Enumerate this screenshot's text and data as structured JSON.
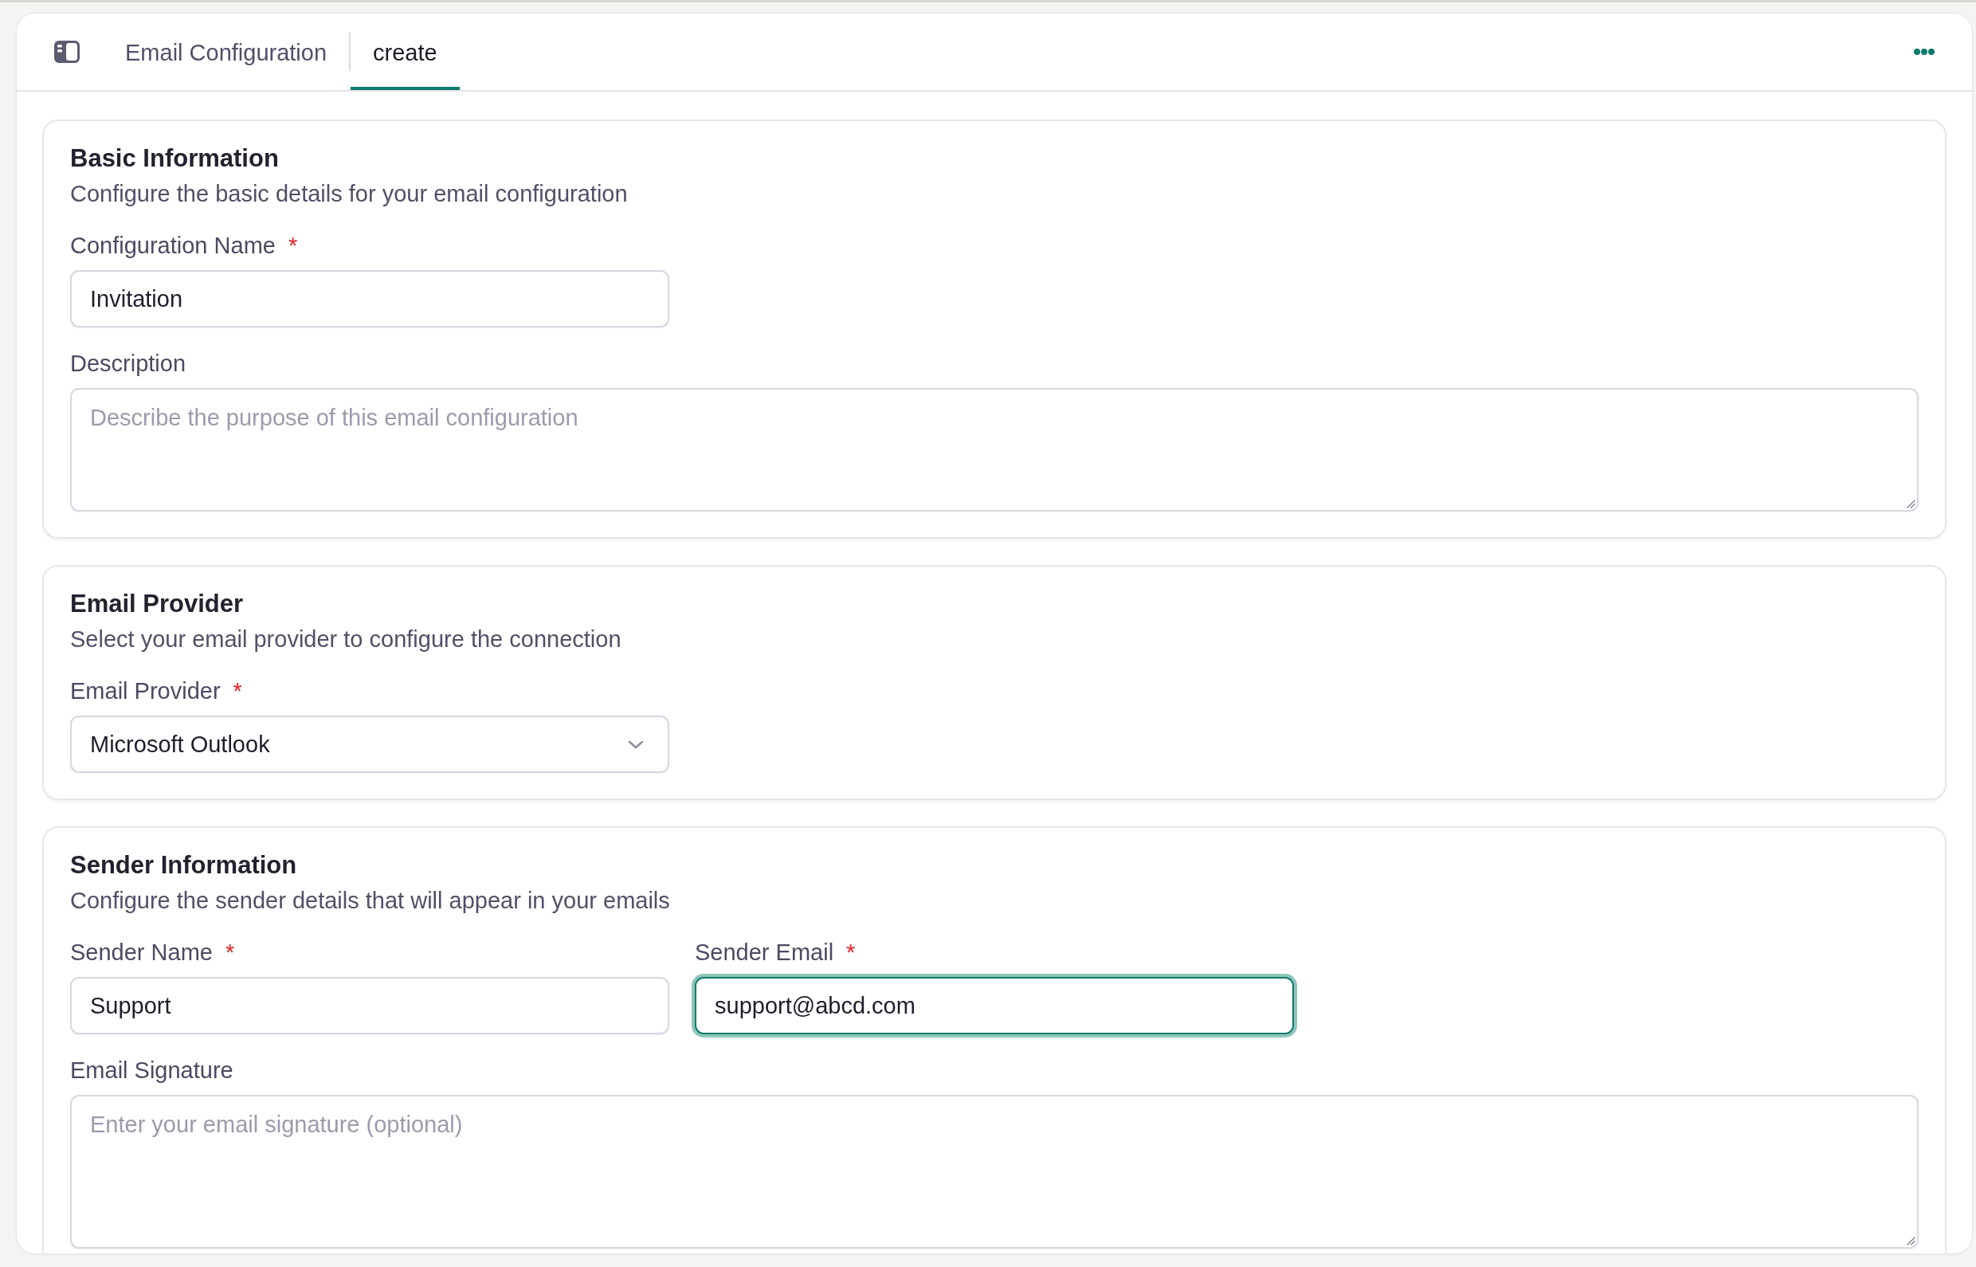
{
  "tabs": [
    {
      "label": "Email Configuration",
      "selected": false
    },
    {
      "label": "create",
      "selected": true
    }
  ],
  "sections": [
    {
      "title": "Basic Information",
      "subtitle": "Configure the basic details for your email configuration",
      "fields": [
        {
          "kind": "text",
          "label": "Configuration Name",
          "required_mark": "*",
          "value": "Invitation",
          "focused": false
        },
        {
          "kind": "textarea",
          "label": "Description",
          "placeholder": "Describe the purpose of this email configuration",
          "focused": false
        }
      ]
    },
    {
      "title": "Email Provider",
      "subtitle": "Select your email provider to configure the connection",
      "fields": [
        {
          "kind": "select",
          "label": "Email Provider",
          "required_mark": "*",
          "value": "Microsoft Outlook",
          "focused": false
        }
      ]
    },
    {
      "title": "Sender Information",
      "subtitle": "Configure the sender details that will appear in your emails",
      "fields": [
        {
          "kind": "text",
          "label": "Sender Name",
          "required_mark": "*",
          "value": "Support",
          "focused": false
        },
        {
          "kind": "text",
          "label": "Sender Email",
          "required_mark": "*",
          "value": "support@abcd.com",
          "focused": true
        },
        {
          "kind": "textarea",
          "label": "Email Signature",
          "placeholder": "Enter your email signature (optional)",
          "focused": false
        }
      ]
    }
  ]
}
